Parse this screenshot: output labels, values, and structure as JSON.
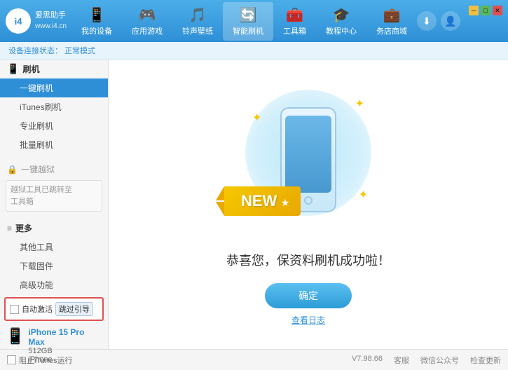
{
  "header": {
    "logo_text1": "爱思助手",
    "logo_text2": "www.i4.cn",
    "logo_abbr": "i4",
    "nav": [
      {
        "id": "my-device",
        "label": "我的设备",
        "icon": "📱"
      },
      {
        "id": "apps-games",
        "label": "应用游戏",
        "icon": "👤"
      },
      {
        "id": "ringtones",
        "label": "铃声壁纸",
        "icon": "🎵"
      },
      {
        "id": "smart-flash",
        "label": "智能刷机",
        "icon": "🔄",
        "active": true
      },
      {
        "id": "toolbox",
        "label": "工具箱",
        "icon": "🧰"
      },
      {
        "id": "tutorials",
        "label": "教程中心",
        "icon": "🎓"
      },
      {
        "id": "service",
        "label": "务店商域",
        "icon": "💼"
      }
    ],
    "download_btn": "⬇",
    "user_btn": "👤"
  },
  "breadcrumb": {
    "prefix": "设备连接状态：",
    "status": "正常模式"
  },
  "sidebar": {
    "section1_icon": "📱",
    "section1_label": "刷机",
    "items": [
      {
        "id": "one-click-flash",
        "label": "一键刷机",
        "active": true
      },
      {
        "id": "itunes-flash",
        "label": "iTunes刷机"
      },
      {
        "id": "pro-flash",
        "label": "专业刷机"
      },
      {
        "id": "batch-flash",
        "label": "批量刷机"
      }
    ],
    "section2_label": "一键越狱",
    "disabled_text": "越狱工具已跳转至\n工具箱",
    "more_label": "更多",
    "more_items": [
      {
        "id": "other-tools",
        "label": "其他工具"
      },
      {
        "id": "download-firmware",
        "label": "下载固件"
      },
      {
        "id": "advanced",
        "label": "高级功能"
      }
    ]
  },
  "content": {
    "new_badge": "NEW",
    "success_message": "恭喜您，保资料刷机成功啦！",
    "confirm_button": "确定",
    "log_link": "查看日志"
  },
  "device": {
    "auto_activate_label": "自动激活",
    "guided_setup_label": "跳过引导",
    "name": "iPhone 15 Pro Max",
    "storage": "512GB",
    "type": "iPhone"
  },
  "bottom_bar": {
    "itunes_label": "阻止iTunes运行",
    "version": "V7.98.66",
    "links": [
      "客服",
      "微信公众号",
      "检查更新"
    ]
  },
  "win_controls": {
    "min": "—",
    "max": "□",
    "close": "✕"
  }
}
